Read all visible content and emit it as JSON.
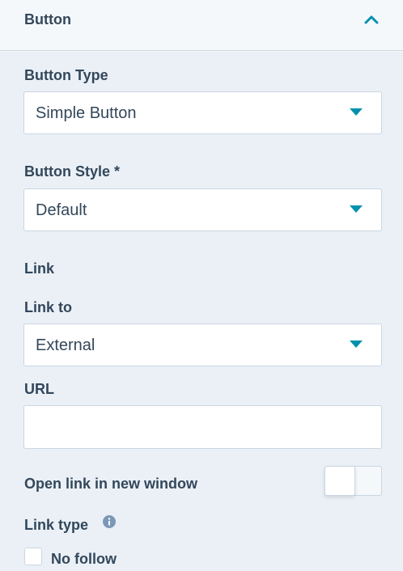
{
  "section": {
    "title": "Button"
  },
  "fields": {
    "button_type": {
      "label": "Button Type",
      "value": "Simple Button"
    },
    "button_style": {
      "label": "Button Style *",
      "value": "Default"
    },
    "link_heading": "Link",
    "link_to": {
      "label": "Link to",
      "value": "External"
    },
    "url": {
      "label": "URL",
      "value": "",
      "placeholder": ""
    },
    "open_new_window": {
      "label": "Open link in new window",
      "enabled": false
    },
    "link_type": {
      "label": "Link type",
      "options": [
        {
          "label": "No follow",
          "checked": false
        }
      ]
    }
  },
  "colors": {
    "accent": "#0091ae",
    "text": "#33475b",
    "border": "#cbd6e2",
    "panel_bg": "#eaf0f6",
    "info_icon": "#7c98b6"
  },
  "icons": {
    "collapse": "chevron-up-icon",
    "dropdown": "caret-down-icon",
    "info": "info-icon"
  }
}
